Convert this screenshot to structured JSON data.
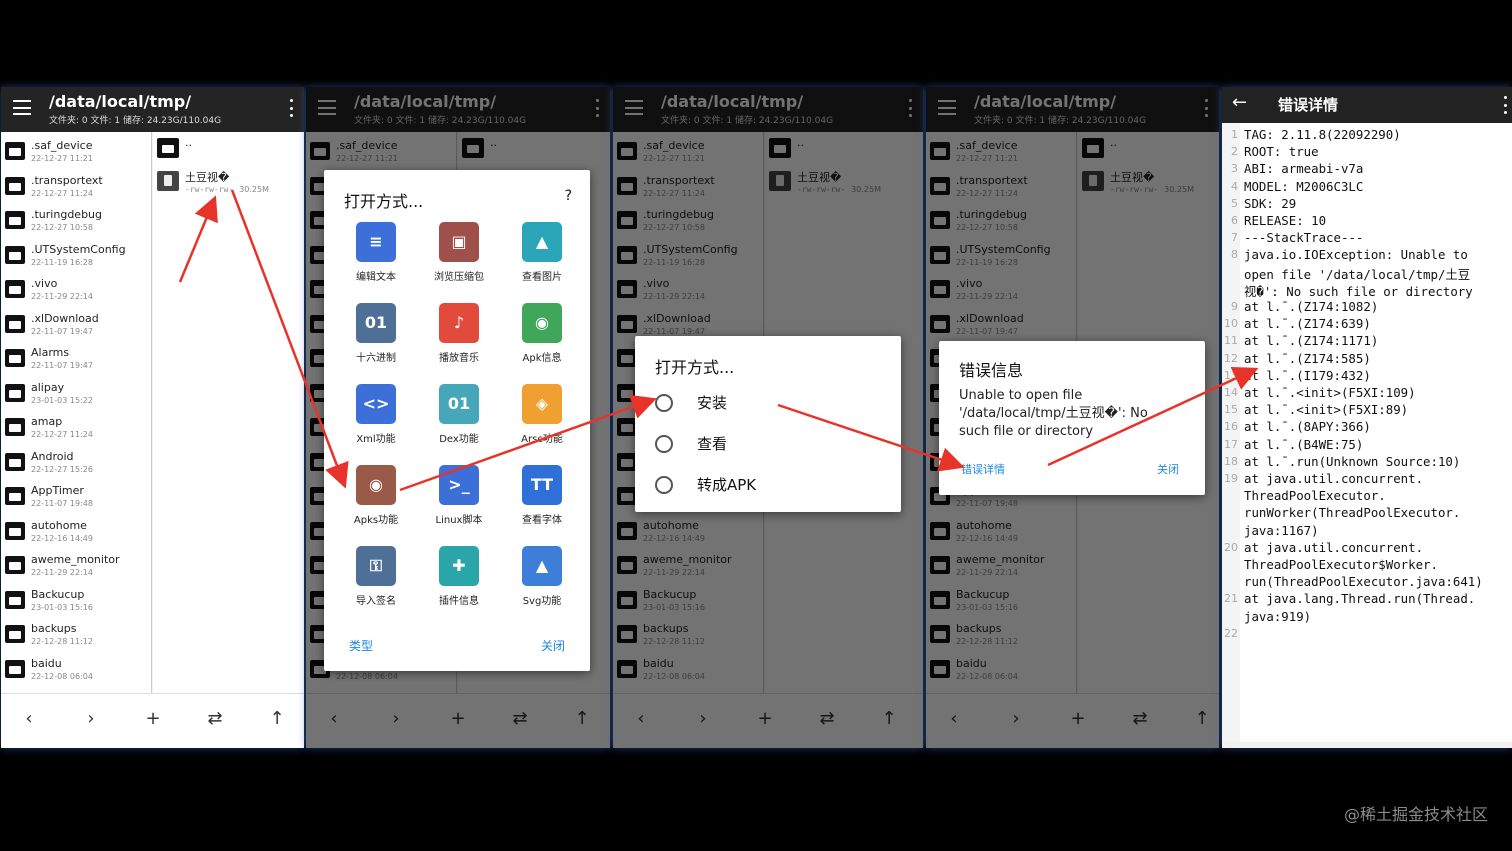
{
  "path": "/data/local/tmp/",
  "info": "文件夹: 0   文件: 1   储存: 24.23G/110.04G",
  "files": [
    {
      "name": ".saf_device",
      "date": "22-12-27 11:21"
    },
    {
      "name": ".transportext",
      "date": "22-12-27 11:24"
    },
    {
      "name": ".turingdebug",
      "date": "22-12-27 10:58"
    },
    {
      "name": ".UTSystemConfig",
      "date": "22-11-19 16:28"
    },
    {
      "name": ".vivo",
      "date": "22-11-29 22:14"
    },
    {
      "name": ".xlDownload",
      "date": "22-11-07 19:47"
    },
    {
      "name": "Alarms",
      "date": "22-11-07 19:47"
    },
    {
      "name": "alipay",
      "date": "23-01-03 15:22"
    },
    {
      "name": "amap",
      "date": "22-12-27 11:24"
    },
    {
      "name": "Android",
      "date": "22-12-27 15:26"
    },
    {
      "name": "AppTimer",
      "date": "22-11-07 19:48"
    },
    {
      "name": "autohome",
      "date": "22-12-16 14:49"
    },
    {
      "name": "aweme_monitor",
      "date": "22-11-29 22:14"
    },
    {
      "name": "Backucup",
      "date": "23-01-03 15:16"
    },
    {
      "name": "backups",
      "date": "22-12-28 11:12"
    },
    {
      "name": "baidu",
      "date": "22-12-08 06:04"
    }
  ],
  "up_label": "..",
  "target": {
    "name": "土豆视�",
    "perm": "-rw-rw-rw-",
    "size": "30.25M"
  },
  "nav": {
    "back": "‹",
    "forward": "›",
    "add": "+",
    "swap": "⇄",
    "up": "↑"
  },
  "open_dialog": {
    "title": "打开方式...",
    "help": "?",
    "items": [
      {
        "label": "编辑文本",
        "icon": "edit-text-icon",
        "glyph": "≡",
        "color": "#3d6fd8"
      },
      {
        "label": "浏览压缩包",
        "icon": "archive-icon",
        "glyph": "▣",
        "color": "#a0504a"
      },
      {
        "label": "查看图片",
        "icon": "image-icon",
        "glyph": "▲",
        "color": "#2aa6b8"
      },
      {
        "label": "十六进制",
        "icon": "hex-icon",
        "glyph": "01",
        "color": "#4e6f96"
      },
      {
        "label": "播放音乐",
        "icon": "music-icon",
        "glyph": "♪",
        "color": "#e24a3b"
      },
      {
        "label": "Apk信息",
        "icon": "android-icon",
        "glyph": "◉",
        "color": "#3fa65a"
      },
      {
        "label": "Xml功能",
        "icon": "xml-icon",
        "glyph": "<>",
        "color": "#3d6fd8"
      },
      {
        "label": "Dex功能",
        "icon": "dex-icon",
        "glyph": "01",
        "color": "#45a7b9"
      },
      {
        "label": "Arsc功能",
        "icon": "layers-icon",
        "glyph": "◈",
        "color": "#f0a030"
      },
      {
        "label": "Apks功能",
        "icon": "apks-icon",
        "glyph": "◉",
        "color": "#9a5a48"
      },
      {
        "label": "Linux脚本",
        "icon": "terminal-icon",
        "glyph": ">_",
        "color": "#3d6fd8"
      },
      {
        "label": "查看字体",
        "icon": "font-icon",
        "glyph": "TT",
        "color": "#2f6fd8"
      },
      {
        "label": "导入签名",
        "icon": "key-icon",
        "glyph": "⚿",
        "color": "#4e6f96"
      },
      {
        "label": "插件信息",
        "icon": "plugin-icon",
        "glyph": "✚",
        "color": "#2aa6a8"
      },
      {
        "label": "Svg功能",
        "icon": "svg-icon",
        "glyph": "▲",
        "color": "#3d7fd8"
      }
    ],
    "type_btn": "类型",
    "close_btn": "关闭"
  },
  "apks_dialog": {
    "title": "打开方式...",
    "options": [
      "安装",
      "查看",
      "转成APK"
    ]
  },
  "error_dialog": {
    "title": "错误信息",
    "message": "Unable to open file '/data/local/tmp/土豆视�': No such file or directory",
    "detail_btn": "错误详情",
    "close_btn": "关闭"
  },
  "detail": {
    "title": "错误详情",
    "lines": [
      {
        "n": "1",
        "t": "TAG: 2.11.8(22092290)"
      },
      {
        "n": "2",
        "t": "ROOT: true"
      },
      {
        "n": "3",
        "t": "ABI: armeabi-v7a"
      },
      {
        "n": "4",
        "t": "MODEL: M2006C3LC"
      },
      {
        "n": "5",
        "t": "SDK: 29"
      },
      {
        "n": "6",
        "t": "RELEASE: 10"
      },
      {
        "n": "7",
        "t": "---StackTrace---"
      },
      {
        "n": "8",
        "t": "java.io.IOException: Unable to"
      },
      {
        "n": "",
        "t": " open file '/data/local/tmp/土豆"
      },
      {
        "n": "",
        "t": " 视�': No such file or directory"
      },
      {
        "n": "9",
        "t": "    at l.¯.(Z174:1082)"
      },
      {
        "n": "10",
        "t": "    at l.¯.(Z174:639)"
      },
      {
        "n": "11",
        "t": "    at l.¯.(Z174:1171)"
      },
      {
        "n": "12",
        "t": "    at l.¯.(Z174:585)"
      },
      {
        "n": "13",
        "t": "    at l.¯.(I179:432)"
      },
      {
        "n": "14",
        "t": "    at l.¯.<init>(F5XI:109)"
      },
      {
        "n": "15",
        "t": "    at l.¯.<init>(F5XI:89)"
      },
      {
        "n": "16",
        "t": "    at l.¯.(8APY:366)"
      },
      {
        "n": "17",
        "t": "    at l.¯.(B4WE:75)"
      },
      {
        "n": "18",
        "t": "    at l.¯.run(Unknown Source:10)"
      },
      {
        "n": "19",
        "t": "    at java.util.concurrent."
      },
      {
        "n": "",
        "t": " ThreadPoolExecutor."
      },
      {
        "n": "",
        "t": " runWorker(ThreadPoolExecutor."
      },
      {
        "n": "",
        "t": " java:1167)"
      },
      {
        "n": "20",
        "t": "    at java.util.concurrent."
      },
      {
        "n": "",
        "t": " ThreadPoolExecutor$Worker."
      },
      {
        "n": "",
        "t": " run(ThreadPoolExecutor.java:641)"
      },
      {
        "n": "21",
        "t": "    at java.lang.Thread.run(Thread."
      },
      {
        "n": "",
        "t": " java:919)"
      },
      {
        "n": "22",
        "t": ""
      }
    ]
  },
  "watermark": "@稀土掘金技术社区",
  "colors": {
    "toolbar": "#242424",
    "accent": "#1e88e5",
    "arrow": "#e8332a"
  }
}
